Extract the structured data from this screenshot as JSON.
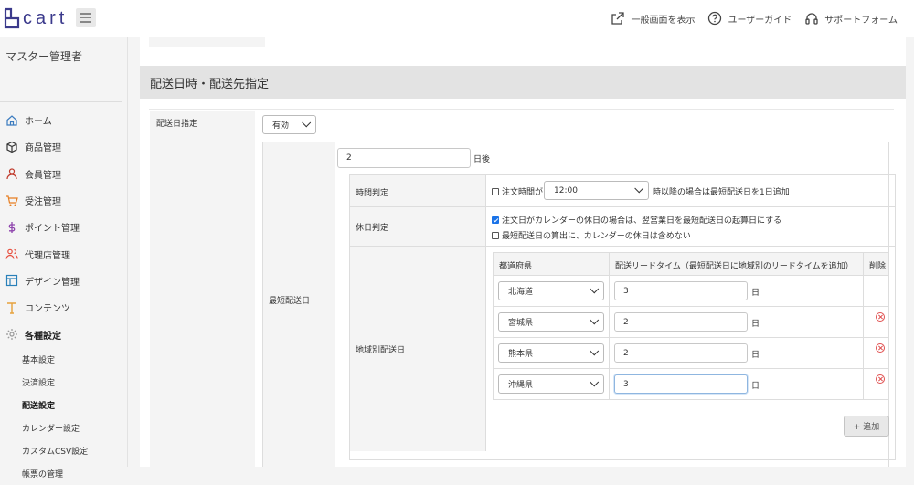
{
  "header": {
    "logo_text": "cart",
    "links": [
      {
        "icon": "external-link-icon",
        "label": "一般画面を表示"
      },
      {
        "icon": "help-circle-icon",
        "label": "ユーザーガイド"
      },
      {
        "icon": "headset-icon",
        "label": "サポートフォーム"
      }
    ]
  },
  "sidebar": {
    "admin_name": "マスター管理者",
    "items": [
      {
        "icon": "home-icon",
        "label": "ホーム",
        "color": "#3a7bbf"
      },
      {
        "icon": "box-icon",
        "label": "商品管理",
        "color": "#333333"
      },
      {
        "icon": "user-icon",
        "label": "会員管理",
        "color": "#c0392b"
      },
      {
        "icon": "cart-icon",
        "label": "受注管理",
        "color": "#e67e22"
      },
      {
        "icon": "dollar-icon",
        "label": "ポイント管理",
        "color": "#8e44ad"
      },
      {
        "icon": "users-icon",
        "label": "代理店管理",
        "color": "#e74c3c"
      },
      {
        "icon": "layout-icon",
        "label": "デザイン管理",
        "color": "#2980b9"
      },
      {
        "icon": "text-icon",
        "label": "コンテンツ",
        "color": "#e6a23c"
      },
      {
        "icon": "gear-icon",
        "label": "各種設定",
        "color": "#999999"
      }
    ],
    "sub_items": [
      "基本設定",
      "決済設定",
      "配送設定",
      "カレンダー設定",
      "カスタムCSV設定",
      "帳票の管理"
    ]
  },
  "section": {
    "title": "配送日時・配送先指定",
    "field_label": "配送日指定",
    "enabled_select": "有効",
    "min_label": "最短配送日",
    "days_value": "2",
    "days_unit": "日後",
    "time_label": "時間判定",
    "time_prefix": "注文時間が",
    "time_value": "12:00",
    "time_suffix": "時以降の場合は最短配送日を1日追加",
    "holiday_label": "休日判定",
    "holiday_opt1": "注文日がカレンダーの休日の場合は、翌営業日を最短配送日の起算日にする",
    "holiday_opt2": "最短配送日の算出に、カレンダーの休日は含めない",
    "region_label": "地域別配送日",
    "col_pref": "都道府県",
    "col_lead": "配送リードタイム（最短配送日に地域別のリードタイムを追加）",
    "col_del": "削除",
    "day_unit": "日",
    "rows": [
      {
        "pref": "北海道",
        "lead": "3"
      },
      {
        "pref": "宮城県",
        "lead": "2"
      },
      {
        "pref": "熊本県",
        "lead": "2"
      },
      {
        "pref": "沖縄県",
        "lead": "3"
      }
    ],
    "add_button": "+ 追加"
  }
}
